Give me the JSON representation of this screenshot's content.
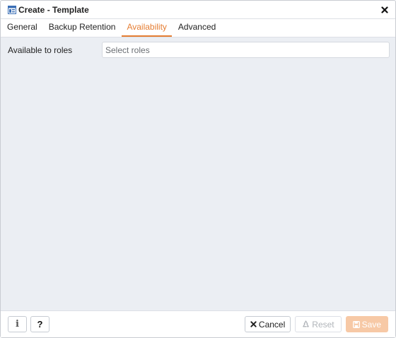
{
  "dialog": {
    "title": "Create - Template",
    "title_icon": "template-icon",
    "close_icon": "close-icon"
  },
  "tabs": [
    {
      "label": "General",
      "active": false
    },
    {
      "label": "Backup Retention",
      "active": false
    },
    {
      "label": "Availability",
      "active": true
    },
    {
      "label": "Advanced",
      "active": false
    }
  ],
  "availability": {
    "roles_label": "Available to roles",
    "roles_placeholder": "Select roles"
  },
  "footer": {
    "info_glyph": "i",
    "help_glyph": "?",
    "cancel_label": "Cancel",
    "reset_label": "Reset",
    "save_label": "Save"
  },
  "colors": {
    "accent": "#e57d32",
    "content_bg": "#ebeef3",
    "save_disabled": "#f7c9a6"
  }
}
